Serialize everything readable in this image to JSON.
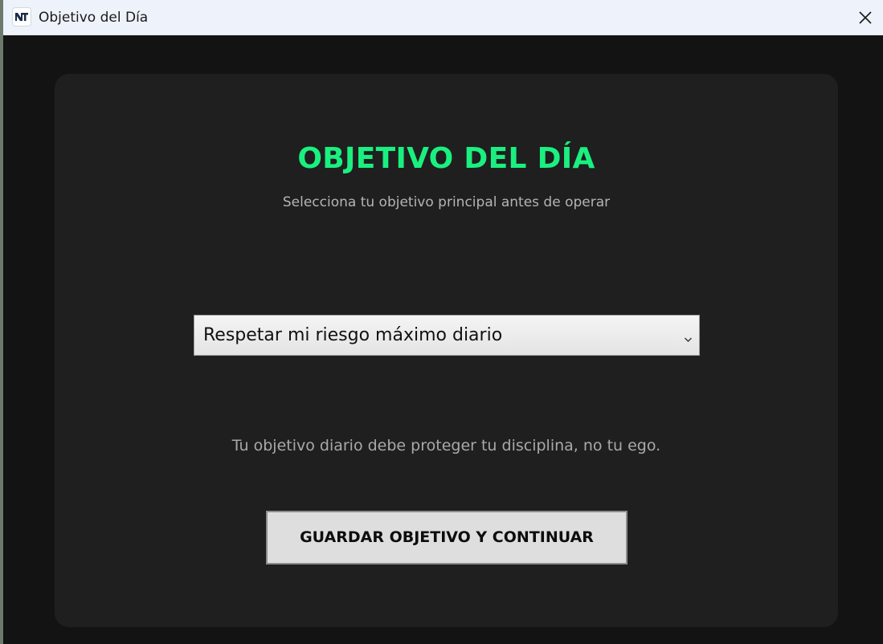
{
  "window": {
    "title": "Objetivo del Día",
    "icon": "nt-logo-icon",
    "close_icon": "close-icon"
  },
  "card": {
    "title": "OBJETIVO DEL DÍA",
    "subtitle": "Selecciona tu objetivo principal antes de operar",
    "objective_select": {
      "selected": "Respetar mi riesgo máximo diario",
      "icon": "chevron-down-icon"
    },
    "hint": "Tu objetivo diario debe proteger tu disciplina, no tu ego.",
    "save_button": "GUARDAR OBJETIVO Y CONTINUAR"
  },
  "colors": {
    "accent_green": "#1af07f",
    "window_background": "#131313",
    "card_background": "#1f1f1f",
    "titlebar_background": "#eef2fa"
  }
}
